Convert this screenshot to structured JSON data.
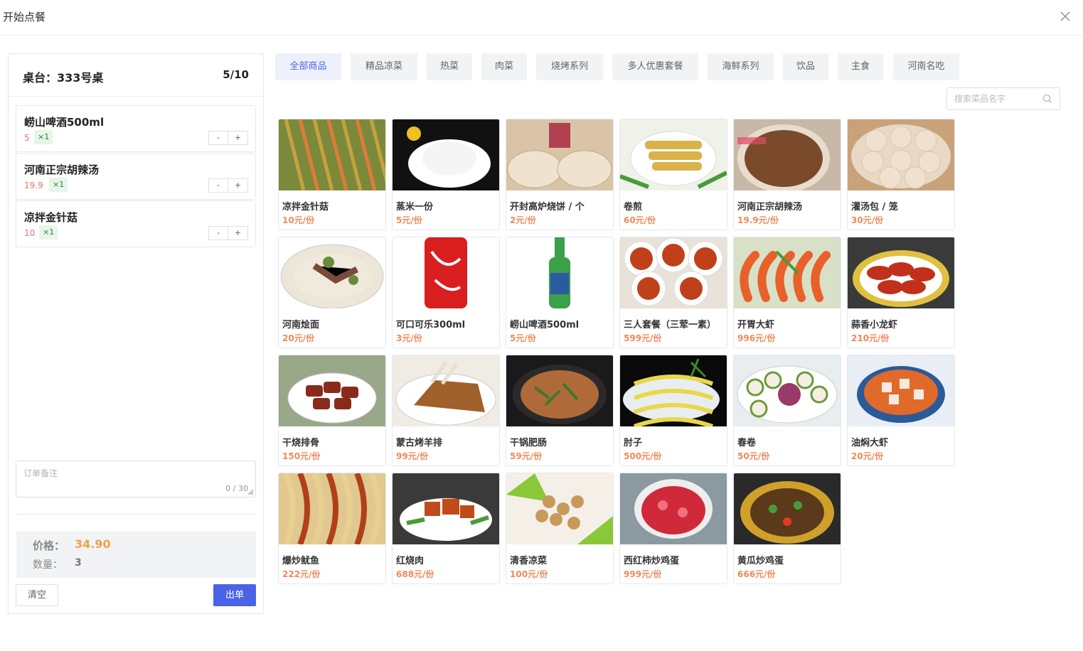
{
  "header": {
    "title": "开始点餐"
  },
  "order": {
    "table_label": "桌台：333号桌",
    "table_count": "5/10",
    "items": [
      {
        "name": "崂山啤酒500ml",
        "price": "5",
        "qty": "×1"
      },
      {
        "name": "河南正宗胡辣汤",
        "price": "19.9",
        "qty": "×1"
      },
      {
        "name": "凉拌金针菇",
        "price": "10",
        "qty": "×1"
      }
    ],
    "stepper_minus": "-",
    "stepper_plus": "+",
    "remark_placeholder": "订单备注",
    "remark_count": "0 / 30",
    "price_label": "价格：",
    "price_value": "34.90",
    "qty_label": "数量：",
    "qty_value": "3",
    "clear_label": "清空",
    "submit_label": "出单"
  },
  "tabs": [
    "全部商品",
    "精品凉菜",
    "热菜",
    "肉菜",
    "烧烤系列",
    "多人优惠套餐",
    "海鲜系列",
    "饮品",
    "主食",
    "河南名吃"
  ],
  "active_tab": 0,
  "search": {
    "placeholder": "搜索菜品名字"
  },
  "products": [
    {
      "name": "凉拌金针菇",
      "price": "10元/份",
      "icon": "noodle-salad",
      "colors": [
        "#7a8a3a",
        "#e07a3a"
      ]
    },
    {
      "name": "蒸米一份",
      "price": "5元/份",
      "icon": "rice-bowl",
      "colors": [
        "#111111",
        "#f5f5f5"
      ]
    },
    {
      "name": "开封高炉烧饼 / 个",
      "price": "2元/份",
      "icon": "flatbread",
      "colors": [
        "#d9c4a8",
        "#efe3cf"
      ]
    },
    {
      "name": "卷煎",
      "price": "60元/份",
      "icon": "fried-cake",
      "colors": [
        "#eef2e8",
        "#d9b24a"
      ]
    },
    {
      "name": "河南正宗胡辣汤",
      "price": "19.9元/份",
      "icon": "soup",
      "colors": [
        "#c8b8a8",
        "#7a4a2a"
      ]
    },
    {
      "name": "灌汤包 / 笼",
      "price": "30元/份",
      "icon": "dumplings",
      "colors": [
        "#c9a27a",
        "#efe0d0"
      ]
    },
    {
      "name": "河南烩面",
      "price": "20元/份",
      "icon": "noodle-soup",
      "colors": [
        "#ece6d8",
        "#6a8a3a"
      ]
    },
    {
      "name": "可口可乐300ml",
      "price": "3元/份",
      "icon": "cola-can",
      "colors": [
        "#ffffff",
        "#d81e1e"
      ]
    },
    {
      "name": "崂山啤酒500ml",
      "price": "5元/份",
      "icon": "beer-bottle",
      "colors": [
        "#ffffff",
        "#3aa04a"
      ]
    },
    {
      "name": "三人套餐（三荤一素）",
      "price": "599元/份",
      "icon": "set-meal",
      "colors": [
        "#e8e2d8",
        "#c0401a"
      ]
    },
    {
      "name": "开胃大虾",
      "price": "996元/份",
      "icon": "shrimp",
      "colors": [
        "#d8e0c8",
        "#e8602a"
      ]
    },
    {
      "name": "蒜香小龙虾",
      "price": "210元/份",
      "icon": "crayfish",
      "colors": [
        "#3a3a3a",
        "#c0301a"
      ]
    },
    {
      "name": "干烧排骨",
      "price": "150元/份",
      "icon": "ribs",
      "colors": [
        "#9aa88a",
        "#8a2a1a"
      ]
    },
    {
      "name": "蒙古烤羊排",
      "price": "99元/份",
      "icon": "lamb-chops",
      "colors": [
        "#f0ece4",
        "#a0602a"
      ]
    },
    {
      "name": "干锅肥肠",
      "price": "59元/份",
      "icon": "dry-pot",
      "colors": [
        "#1a1a1a",
        "#b06a3a"
      ]
    },
    {
      "name": "肘子",
      "price": "500元/份",
      "icon": "fish-plate",
      "colors": [
        "#0a0a0a",
        "#e8d84a"
      ]
    },
    {
      "name": "春卷",
      "price": "50元/份",
      "icon": "spring-rolls",
      "colors": [
        "#e8eef0",
        "#9a3a6a"
      ]
    },
    {
      "name": "油焖大虾",
      "price": "20元/份",
      "icon": "braised-shrimp",
      "colors": [
        "#e8eef4",
        "#e06a2a"
      ]
    },
    {
      "name": "爆炒鱿鱼",
      "price": "222元/份",
      "icon": "stir-fry",
      "colors": [
        "#e0c890",
        "#b0401a"
      ]
    },
    {
      "name": "红烧肉",
      "price": "688元/份",
      "icon": "braised-pork",
      "colors": [
        "#3a3a3a",
        "#c04a1a"
      ]
    },
    {
      "name": "清香凉菜",
      "price": "100元/份",
      "icon": "cold-dish",
      "colors": [
        "#f4f0e8",
        "#c89a5a"
      ]
    },
    {
      "name": "西红柿炒鸡蛋",
      "price": "999元/份",
      "icon": "tomato-egg",
      "colors": [
        "#8a9aa0",
        "#d02a3a"
      ]
    },
    {
      "name": "黄瓜炒鸡蛋",
      "price": "666元/份",
      "icon": "cucumber-egg",
      "colors": [
        "#2a2a2a",
        "#d0a02a"
      ]
    }
  ]
}
